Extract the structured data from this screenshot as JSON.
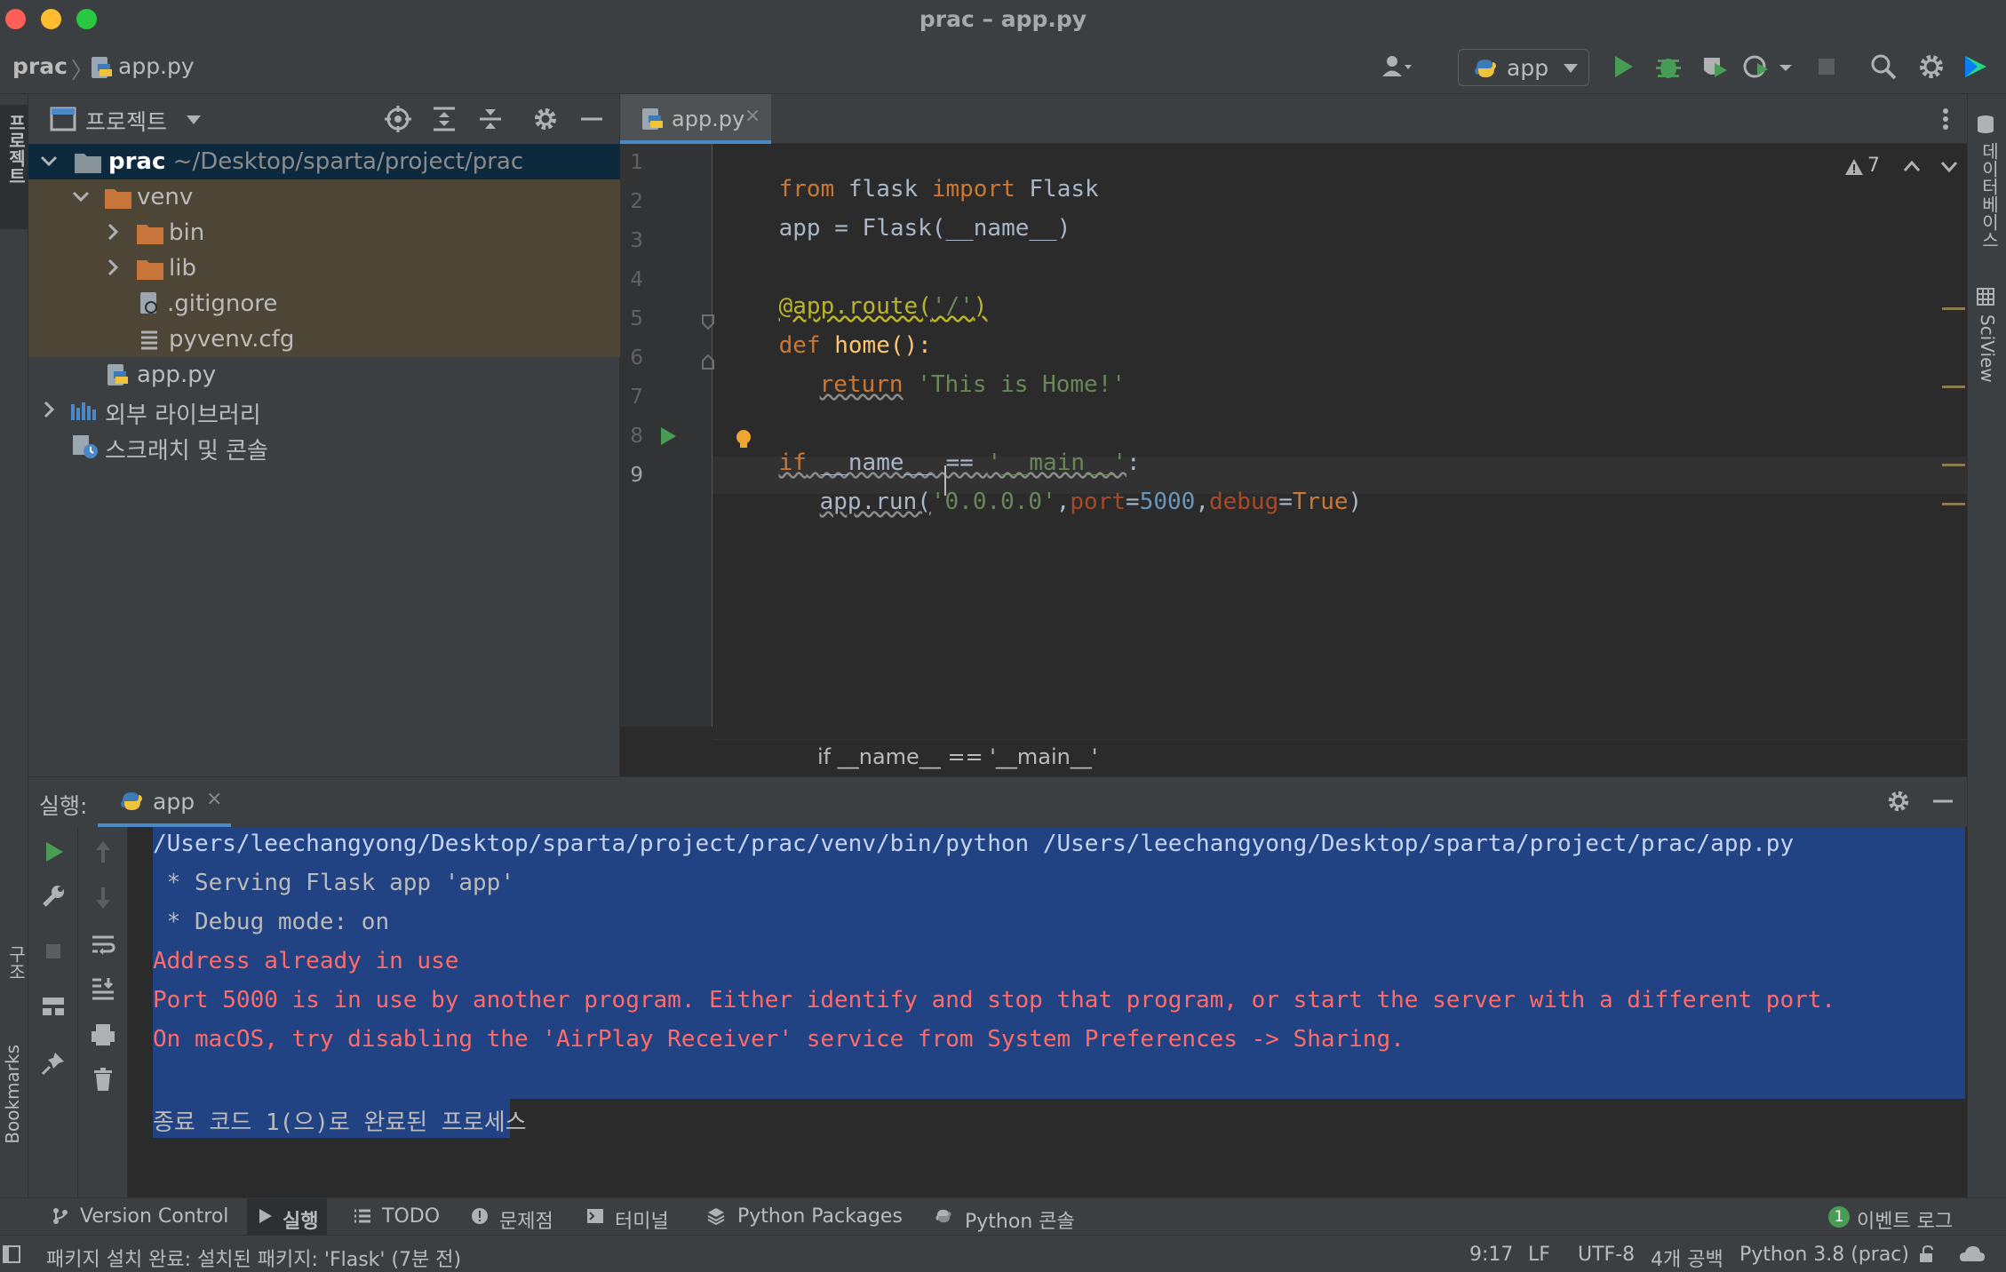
{
  "window": {
    "title": "prac – app.py"
  },
  "navbar": {
    "project": "prac",
    "separator": "〉",
    "file": "app.py",
    "run_config": "app"
  },
  "left_strip": {
    "project_tab": "프로젝트",
    "structure_tab": "구조",
    "bookmarks_tab": "Bookmarks"
  },
  "right_strip": {
    "database_tab": "데이터베이스",
    "sciview_tab": "SciView"
  },
  "project_panel": {
    "title": "프로젝트",
    "tree": [
      {
        "label": "prac",
        "path": "~/Desktop/sparta/project/prac"
      },
      {
        "label": "venv"
      },
      {
        "label": "bin"
      },
      {
        "label": "lib"
      },
      {
        "label": ".gitignore"
      },
      {
        "label": "pyvenv.cfg"
      },
      {
        "label": "app.py"
      },
      {
        "label": "외부 라이브러리"
      },
      {
        "label": "스크래치 및 콘솔"
      }
    ]
  },
  "editor": {
    "tab": "app.py",
    "tab_close": "×",
    "warnings": "7",
    "breadcrumb": "if __name__ == '__main__'",
    "line_numbers": [
      "1",
      "2",
      "3",
      "4",
      "5",
      "6",
      "7",
      "8",
      "9"
    ],
    "lines": {
      "l1": {
        "a": "from",
        "b": " flask ",
        "c": "import",
        "d": " Flask"
      },
      "l2": {
        "a": "app = Flask(__name__)"
      },
      "l4": {
        "a": "@app.route(",
        "b": "'/'",
        "c": ")"
      },
      "l5": {
        "a": "def",
        "b": " home():"
      },
      "l6": {
        "a": "return",
        "b": " 'This is Home!'"
      },
      "l8": {
        "a": "if",
        "b": " __name__ == ",
        "c": "'__main__'",
        "d": ":"
      },
      "l9": {
        "a": "app.run(",
        "b": "'0.0.0.0'",
        "c": ",",
        "d": "port",
        "e": "=",
        "f": "5000",
        "g": ",",
        "h": "debug",
        "i": "=",
        "j": "True",
        "k": ")"
      }
    }
  },
  "run_panel": {
    "prefix": "실행:",
    "tab": "app",
    "tab_close": "×",
    "console": [
      "/Users/leechangyong/Desktop/sparta/project/prac/venv/bin/python /Users/leechangyong/Desktop/sparta/project/prac/app.py",
      " * Serving Flask app 'app'",
      " * Debug mode: on",
      "Address already in use",
      "Port 5000 is in use by another program. Either identify and stop that program, or start the server with a different port.",
      "On macOS, try disabling the 'AirPlay Receiver' service from System Preferences -> Sharing.",
      "",
      "종료 코드 1(으)로 완료된 프로세스"
    ]
  },
  "bottom_tabs": [
    "Version Control",
    "실행",
    "TODO",
    "문제점",
    "터미널",
    "Python Packages",
    "Python 콘솔"
  ],
  "event_log": {
    "count": "1",
    "label": "이벤트 로그"
  },
  "status": {
    "message": "패키지 설치 완료: 설치된 패키지: 'Flask' (7분 전)",
    "position": "9:17",
    "line_sep": "LF",
    "encoding": "UTF-8",
    "indent": "4개 공백",
    "interpreter": "Python 3.8 (prac)"
  },
  "colors": {
    "accent": "#4a88c7",
    "run_green": "#499c54",
    "error": "#ff6b68",
    "selection": "#214283",
    "folder": "#c7753b"
  }
}
